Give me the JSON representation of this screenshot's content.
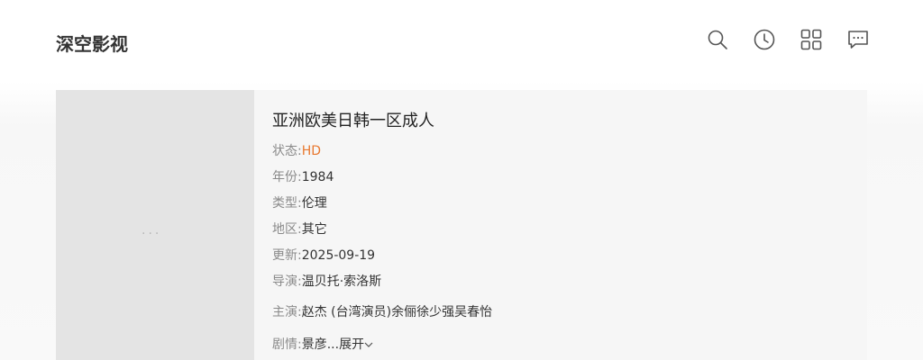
{
  "header": {
    "logo": "深空影视",
    "icons": [
      "search-icon",
      "history-icon",
      "grid-icon",
      "message-icon"
    ]
  },
  "poster": {
    "loading": "···"
  },
  "detail": {
    "title": "亚洲欧美日韩一区成人",
    "fields": {
      "status_label": "状态:",
      "status_value": "HD",
      "year_label": "年份:",
      "year_value": "1984",
      "type_label": "类型:",
      "type_value": "伦理",
      "region_label": "地区:",
      "region_value": "其它",
      "update_label": "更新:",
      "update_value": "2025-09-19",
      "director_label": "导演:",
      "director_value": "温贝托·索洛斯",
      "cast_label": "主演:",
      "cast_value": "赵杰 (台湾演员)余俪徐少强吴春怡",
      "plot_label": "剧情:",
      "plot_value": "景彦...",
      "expand_label": "展开"
    }
  },
  "colors": {
    "accent": "#e8772e",
    "label": "#8a8a8a",
    "text": "#333333"
  }
}
